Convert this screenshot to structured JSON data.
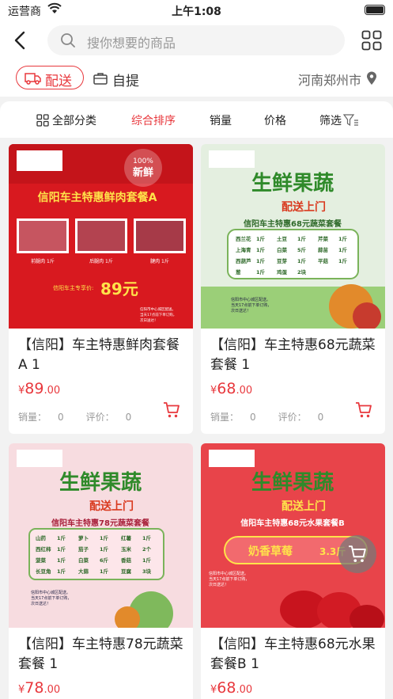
{
  "status_bar": {
    "carrier": "运营商",
    "time": "上午1:08"
  },
  "header": {
    "search_placeholder": "搜你想要的商品"
  },
  "delivery": {
    "delivery_label": "配送",
    "pickup_label": "自提",
    "city": "河南郑州市"
  },
  "sort_bar": {
    "all_categories": "全部分类",
    "default_sort": "综合排序",
    "sales": "销量",
    "price": "价格",
    "filter": "筛选"
  },
  "colors": {
    "accent": "#e8383d"
  },
  "products": [
    {
      "title": "【信阳】车主特惠鲜肉套餐A 1",
      "price_int": "89",
      "price_dec": ".00",
      "currency": "¥",
      "sales_label": "销量：",
      "sales": "0",
      "review_label": "评价：",
      "reviews": "0",
      "image": {
        "badge": "100% 新鲜",
        "headline": "信阳车主特惠鲜肉套餐A",
        "items": [
          "前腿肉 1斤",
          "后腿肉 1斤",
          "腱肉 1斤"
        ],
        "price_label": "信阳车主专享价:",
        "price": "89元",
        "notes": [
          "信阳市中心城区配送。",
          "当天17点前下单订购，",
          "次日送达！"
        ]
      }
    },
    {
      "title": "【信阳】车主特惠68元蔬菜套餐 1",
      "price_int": "68",
      "price_dec": ".00",
      "currency": "¥",
      "sales_label": "销量：",
      "sales": "0",
      "review_label": "评价：",
      "reviews": "0",
      "image": {
        "line1": "生鲜果蔬",
        "line2": "配送上门",
        "headline": "信阳车主特惠68元蔬菜套餐",
        "rows": [
          [
            "西兰花",
            "1斤",
            "土豆",
            "1斤",
            "芹菜",
            "1斤"
          ],
          [
            "上海青",
            "1斤",
            "白菜",
            "5斤",
            "蒜苗",
            "1斤"
          ],
          [
            "西葫芦",
            "1斤",
            "豆芽",
            "1斤",
            "平菇",
            "1斤"
          ],
          [
            "葱",
            "1斤",
            "鸡蛋",
            "2块",
            "",
            ""
          ]
        ],
        "notes": [
          "信阳市中心城区配送。",
          "当天17点前下单订购，",
          "次日送达！"
        ]
      }
    },
    {
      "title": "【信阳】车主特惠78元蔬菜套餐 1",
      "price_int": "78",
      "price_dec": ".00",
      "currency": "¥",
      "image": {
        "line1": "生鲜果蔬",
        "line2": "配送上门",
        "headline": "信阳车主特惠78元蔬菜套餐",
        "rows": [
          [
            "山药",
            "1斤",
            "萝卜",
            "1斤",
            "红薯",
            "1斤"
          ],
          [
            "西红柿",
            "1斤",
            "茄子",
            "1斤",
            "玉米",
            "2个"
          ],
          [
            "菠菜",
            "1斤",
            "白菜",
            "6斤",
            "香菇",
            "1斤"
          ],
          [
            "长豆角",
            "1斤",
            "大蒜",
            "1斤",
            "豆腐",
            "3块"
          ]
        ],
        "notes": [
          "信阳市中心城区配送。",
          "当天17点前下单订购，",
          "次日送达！"
        ]
      }
    },
    {
      "title": "【信阳】车主特惠68元水果套餐B 1",
      "price_int": "68",
      "price_dec": ".00",
      "currency": "¥",
      "image": {
        "line1": "生鲜果蔬",
        "line2": "配送上门",
        "headline": "信阳车主特惠68元水果套餐B",
        "fruit": "奶香草莓",
        "weight": "3.3斤",
        "notes": [
          "信阳市中心城区配送。",
          "当天17点前下单订购，",
          "次日送达！"
        ]
      }
    }
  ]
}
